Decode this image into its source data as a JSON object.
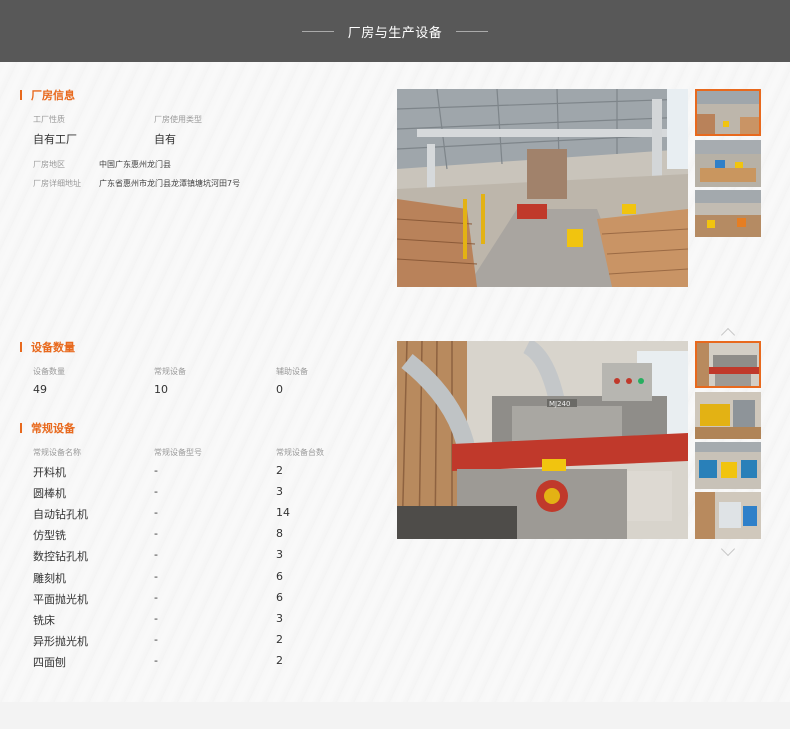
{
  "header": {
    "title": "厂房与生产设备"
  },
  "factory": {
    "section_title": "厂房信息",
    "nature_label": "工厂性质",
    "nature_value": "自有工厂",
    "usage_label": "厂房使用类型",
    "usage_value": "自有",
    "region_label": "厂房地区",
    "region_value": "中国广东惠州龙门县",
    "address_label": "厂房详细地址",
    "address_value": "广东省惠州市龙门县龙潭镇塘坑河田7号"
  },
  "equipment_count": {
    "section_title": "设备数量",
    "total_label": "设备数量",
    "total_value": "49",
    "regular_label": "常规设备",
    "regular_value": "10",
    "aux_label": "辅助设备",
    "aux_value": "0"
  },
  "regular_equipment": {
    "section_title": "常规设备",
    "headers": [
      "常规设备名称",
      "常规设备型号",
      "常规设备台数"
    ],
    "rows": [
      {
        "name": "开料机",
        "model": "-",
        "count": "2"
      },
      {
        "name": "圆棒机",
        "model": "-",
        "count": "3"
      },
      {
        "name": "自动钻孔机",
        "model": "-",
        "count": "14"
      },
      {
        "name": "仿型铣",
        "model": "-",
        "count": "8"
      },
      {
        "name": "数控钻孔机",
        "model": "-",
        "count": "3"
      },
      {
        "name": "雕刻机",
        "model": "-",
        "count": "6"
      },
      {
        "name": "平面抛光机",
        "model": "-",
        "count": "6"
      },
      {
        "name": "铣床",
        "model": "-",
        "count": "3"
      },
      {
        "name": "异形抛光机",
        "model": "-",
        "count": "2"
      },
      {
        "name": "四面刨",
        "model": "-",
        "count": "2"
      }
    ]
  },
  "machine_plate": "MJ240",
  "colors": {
    "accent": "#e8691d",
    "header_bg": "#585858"
  }
}
